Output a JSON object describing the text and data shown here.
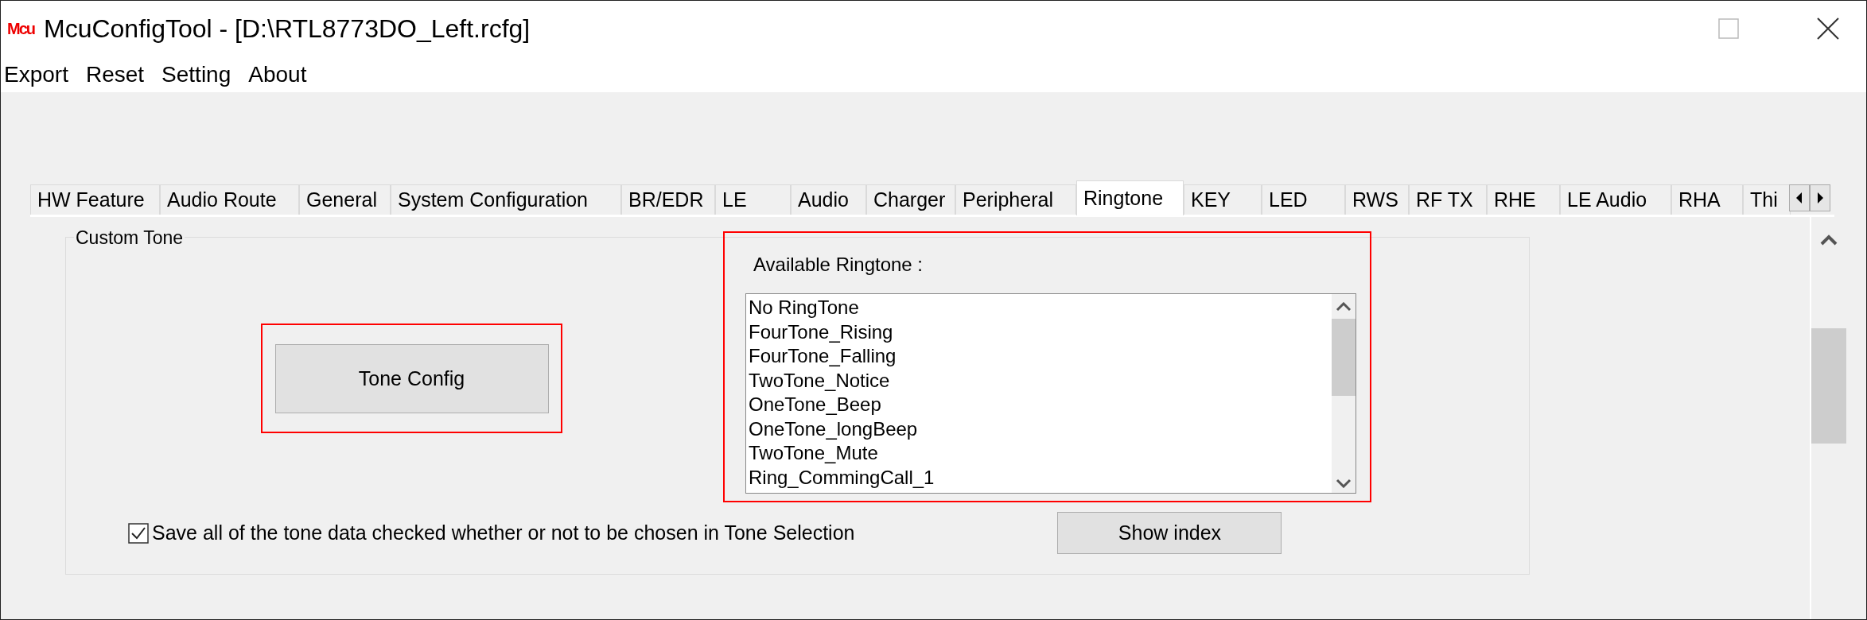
{
  "window": {
    "app_icon_text": "Mcu",
    "title": "McuConfigTool - [D:\\RTL8773DO_Left.rcfg]"
  },
  "menu": [
    "Export",
    "Reset",
    "Setting",
    "About"
  ],
  "tabs": [
    {
      "label": "HW Feature",
      "selected": false
    },
    {
      "label": "Audio Route",
      "selected": false
    },
    {
      "label": "General",
      "selected": false
    },
    {
      "label": "System Configuration",
      "selected": false
    },
    {
      "label": "BR/EDR",
      "selected": false
    },
    {
      "label": "LE",
      "selected": false
    },
    {
      "label": "Audio",
      "selected": false
    },
    {
      "label": "Charger",
      "selected": false
    },
    {
      "label": "Peripheral",
      "selected": false
    },
    {
      "label": "Ringtone",
      "selected": true
    },
    {
      "label": "KEY",
      "selected": false
    },
    {
      "label": "LED",
      "selected": false
    },
    {
      "label": "RWS",
      "selected": false
    },
    {
      "label": "RF TX",
      "selected": false
    },
    {
      "label": "RHE",
      "selected": false
    },
    {
      "label": "LE Audio",
      "selected": false
    },
    {
      "label": "RHA",
      "selected": false
    },
    {
      "label": "Thi",
      "selected": false
    }
  ],
  "custom_tone": {
    "title": "Custom Tone",
    "tone_config_button": "Tone Config",
    "ringtone_label": "Available Ringtone :",
    "ringtones": [
      "No RingTone",
      "FourTone_Rising",
      "FourTone_Falling",
      "TwoTone_Notice",
      "OneTone_Beep",
      "OneTone_longBeep",
      "TwoTone_Mute",
      "Ring_CommingCall_1"
    ],
    "save_all": {
      "label": "Save all of the tone data checked whether or not to be chosen in Tone Selection",
      "checked": true
    },
    "show_index_button": "Show index"
  }
}
